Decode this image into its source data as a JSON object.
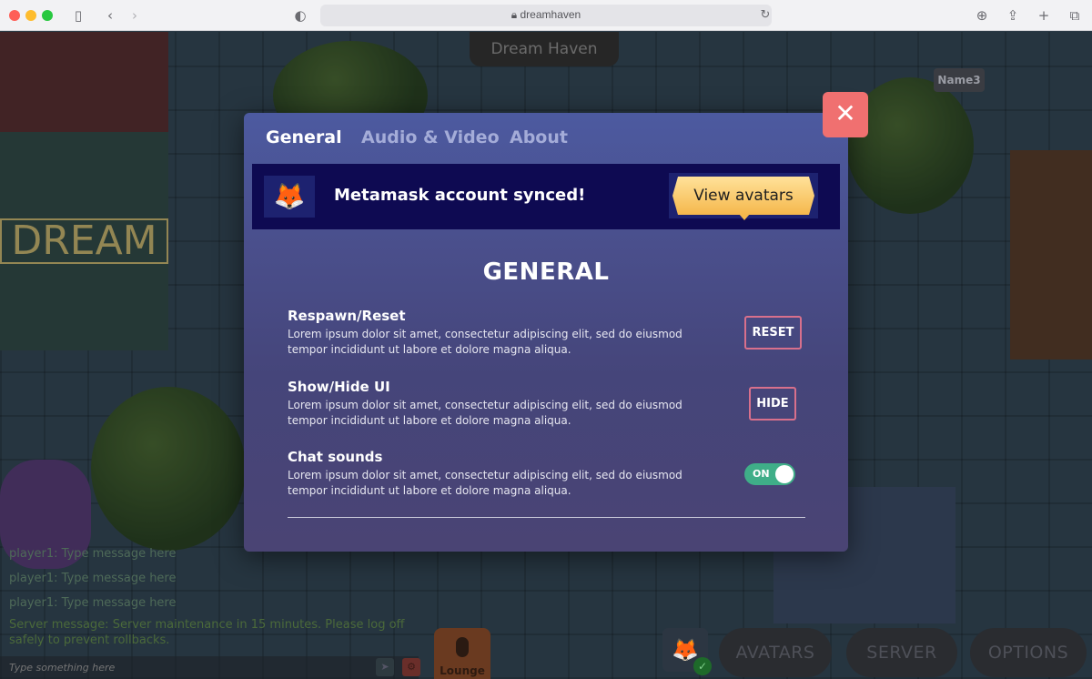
{
  "browser": {
    "url": "dreamhaven"
  },
  "world": {
    "title": "Dream Haven",
    "sign_text": "DREAM",
    "name_tag": "Name3",
    "chat": {
      "messages": [
        "player1: Type message here",
        "player1: Type message here",
        "player1: Type message here"
      ],
      "server_message": "Server message: Server maintenance in 15 minutes. Please log off safely to prevent rollbacks.",
      "input_placeholder": "Type something here"
    },
    "lounge_label": "Lounge",
    "bottom_buttons": [
      "AVATARS",
      "SERVER",
      "OPTIONS"
    ]
  },
  "modal": {
    "tabs": [
      {
        "label": "General",
        "active": true
      },
      {
        "label": "Audio & Video",
        "active": false
      },
      {
        "label": "About",
        "active": false
      }
    ],
    "banner": {
      "text": "Metamask account synced!",
      "button_label": "View avatars"
    },
    "section_title": "GENERAL",
    "settings": [
      {
        "title": "Respawn/Reset",
        "description": "Lorem ipsum dolor sit amet, consectetur adipiscing elit, sed do eiusmod tempor incididunt ut labore et dolore magna aliqua.",
        "action_label": "RESET"
      },
      {
        "title": "Show/Hide UI",
        "description": "Lorem ipsum dolor sit amet, consectetur adipiscing elit, sed do eiusmod tempor incididunt ut labore et dolore magna aliqua.",
        "action_label": "HIDE"
      },
      {
        "title": "Chat sounds",
        "description": "Lorem ipsum dolor sit amet, consectetur adipiscing elit, sed do eiusmod tempor incididunt ut labore et dolore magna aliqua.",
        "toggle_label": "ON",
        "toggle_on": true
      }
    ]
  },
  "colors": {
    "accent_close": "#f07070",
    "toggle_on": "#3fae88",
    "button_border": "#d8708c",
    "banner_bg": "#0e0a52",
    "cta_gold": "#f5b84c"
  }
}
